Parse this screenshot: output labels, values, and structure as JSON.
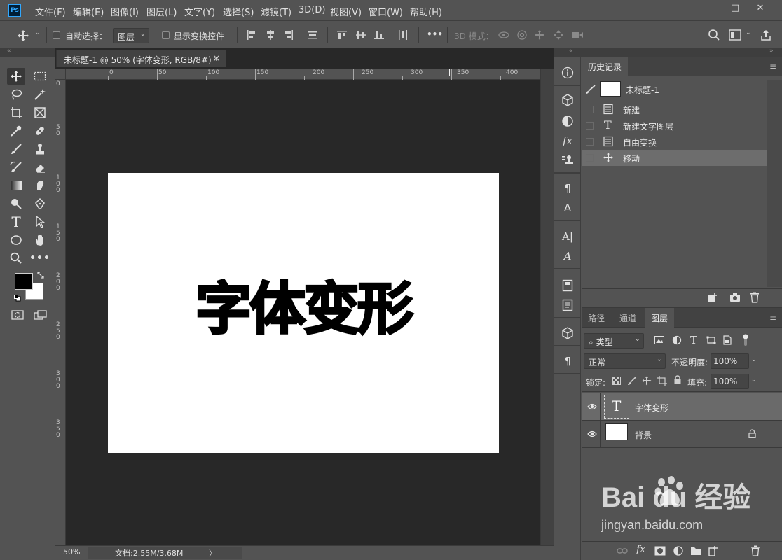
{
  "app": {
    "logo": "Ps"
  },
  "menu": {
    "items": [
      "文件(F)",
      "编辑(E)",
      "图像(I)",
      "图层(L)",
      "文字(Y)",
      "选择(S)",
      "滤镜(T)",
      "3D(D)",
      "视图(V)",
      "窗口(W)",
      "帮助(H)"
    ]
  },
  "window_controls": {
    "minimize": "—",
    "maximize": "□",
    "close": "✕"
  },
  "options_bar": {
    "auto_select_label": "自动选择：",
    "auto_select_target": "图层",
    "show_transform_label": "显示变换控件",
    "three_d_mode_label": "3D 模式：",
    "more_label": "•••"
  },
  "document": {
    "tab_title": "未标题-1 @ 50% (字体变形, RGB/8#) *",
    "tab_close": "×",
    "canvas_text": "字体变形",
    "canvas_color": "#ffffff",
    "pasteboard_color": "#282828",
    "ruler_h_labels": [
      "0",
      "50",
      "100",
      "150",
      "200",
      "250",
      "300",
      "350",
      "400"
    ],
    "ruler_v_labels": [
      "0",
      "5\n0",
      "1\n0\n0",
      "1\n5\n0",
      "2\n0\n0",
      "2\n5\n0",
      "3\n0\n0",
      "3\n5\n0"
    ],
    "zoom": "50%",
    "doc_info": "文档:2.55M/3.68M",
    "status_arrow": "〉"
  },
  "history_panel": {
    "tab_label": "历史记录",
    "snapshot_name": "未标题-1",
    "items": [
      {
        "label": "新建",
        "icon": "document-icon"
      },
      {
        "label": "新建文字图层",
        "icon": "type-icon"
      },
      {
        "label": "自由变换",
        "icon": "document-icon"
      },
      {
        "label": "移动",
        "icon": "move-icon"
      }
    ],
    "selected_index": 3
  },
  "layers_panel": {
    "tabs": [
      "路径",
      "通道",
      "图层"
    ],
    "active_tab": "图层",
    "filter_label": "类型",
    "blend_mode": "正常",
    "opacity_label": "不透明度:",
    "opacity_value": "100%",
    "lock_label": "锁定:",
    "fill_label": "填充:",
    "fill_value": "100%",
    "layers": [
      {
        "name": "字体变形",
        "type": "text",
        "selected": true,
        "visible": true
      },
      {
        "name": "背景",
        "type": "background",
        "selected": false,
        "visible": true,
        "locked": true
      }
    ]
  },
  "watermark": {
    "main": "Bai du 经验",
    "sub": "jingyan.baidu.com"
  },
  "colors": {
    "accent": "#31a8ff",
    "panel": "#535353",
    "dark": "#282828",
    "selected": "#6d6d6d"
  }
}
